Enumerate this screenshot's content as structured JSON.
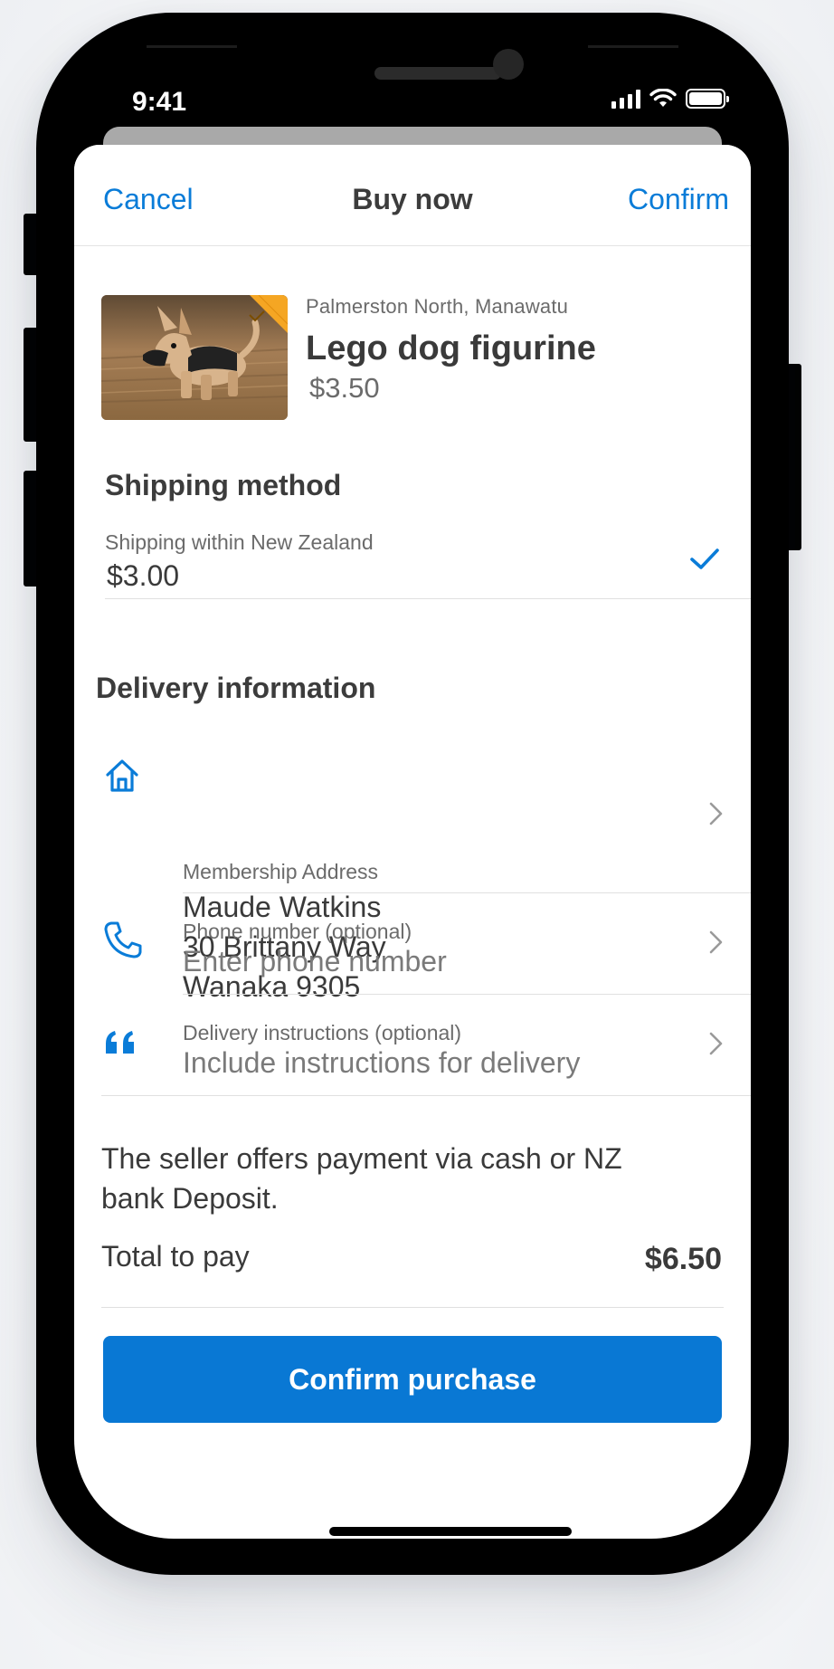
{
  "status_bar": {
    "time": "9:41"
  },
  "nav": {
    "cancel": "Cancel",
    "title": "Buy now",
    "confirm": "Confirm"
  },
  "listing": {
    "location": "Palmerston North, Manawatu",
    "title": "Lego dog figurine",
    "price": "$3.50"
  },
  "shipping": {
    "heading": "Shipping method",
    "option_label": "Shipping within New Zealand",
    "option_price": "$3.00",
    "selected": true
  },
  "delivery": {
    "heading": "Delivery information",
    "address": {
      "label": "Membership Address",
      "name": "Maude Watkins",
      "street": "30 Brittany Way",
      "city": "Wanaka 9305",
      "icon": "home-icon"
    },
    "phone": {
      "label": "Phone number (optional)",
      "placeholder": "Enter phone number",
      "icon": "phone-icon"
    },
    "instructions": {
      "label": "Delivery instructions (optional)",
      "placeholder": "Include instructions for delivery",
      "icon": "quote-icon"
    }
  },
  "payment": {
    "note": "The seller offers payment via cash or NZ bank Deposit.",
    "total_label": "Total to pay",
    "total_value": "$6.50",
    "button": "Confirm purchase"
  },
  "colors": {
    "accent": "#0978d4",
    "link": "#0a7cd8",
    "badge": "#f5a623"
  }
}
